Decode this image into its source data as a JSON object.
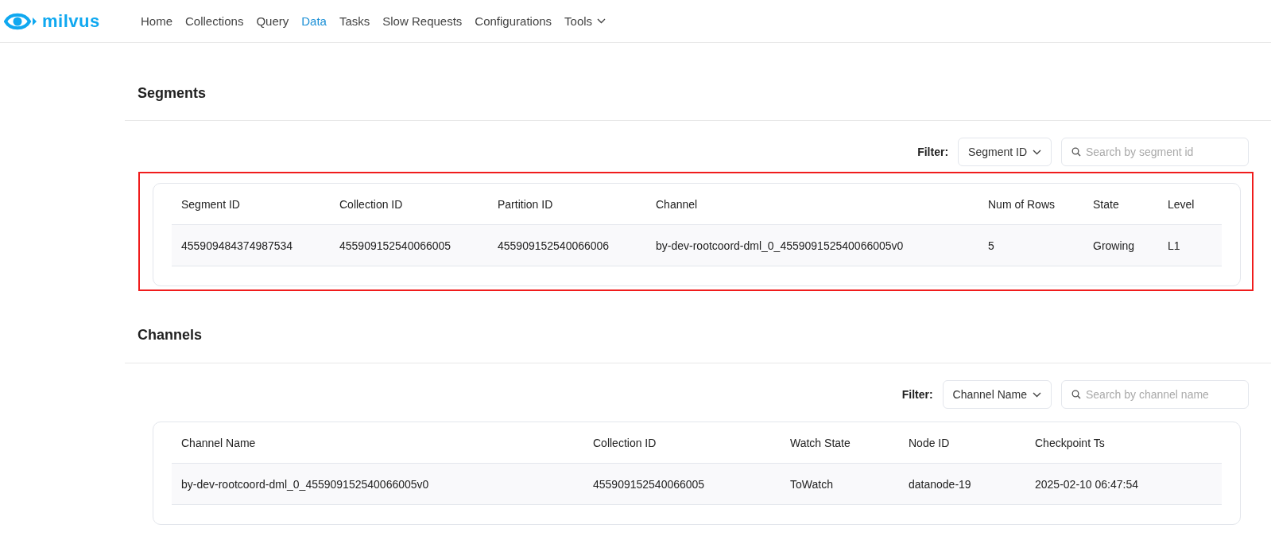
{
  "brand": {
    "name": "milvus"
  },
  "nav": [
    {
      "label": "Home",
      "selected": false
    },
    {
      "label": "Collections",
      "selected": false
    },
    {
      "label": "Query",
      "selected": false
    },
    {
      "label": "Data",
      "selected": true
    },
    {
      "label": "Tasks",
      "selected": false
    },
    {
      "label": "Slow Requests",
      "selected": false
    },
    {
      "label": "Configurations",
      "selected": false
    },
    {
      "label": "Tools",
      "selected": false,
      "dropdown": true
    }
  ],
  "sections": [
    {
      "title": "Segments",
      "filter_label": "Filter:",
      "filter_select": "Segment ID",
      "search": {
        "placeholder": "Search by segment id"
      },
      "highlighted": true,
      "table": {
        "columns": [
          "Segment ID",
          "Collection ID",
          "Partition ID",
          "Channel",
          "Num of Rows",
          "State",
          "Level"
        ],
        "rows": [
          [
            "455909484374987534",
            "455909152540066005",
            "455909152540066006",
            "by-dev-rootcoord-dml_0_455909152540066005v0",
            "5",
            "Growing",
            "L1"
          ]
        ]
      }
    },
    {
      "title": "Channels",
      "filter_label": "Filter:",
      "filter_select": "Channel Name",
      "search": {
        "placeholder": "Search by channel name"
      },
      "highlighted": false,
      "table": {
        "columns": [
          "Channel Name",
          "Collection ID",
          "Watch State",
          "Node ID",
          "Checkpoint Ts"
        ],
        "rows": [
          [
            "by-dev-rootcoord-dml_0_455909152540066005v0",
            "455909152540066005",
            "ToWatch",
            "datanode-19",
            "2025-02-10 06:47:54"
          ]
        ]
      }
    }
  ]
}
